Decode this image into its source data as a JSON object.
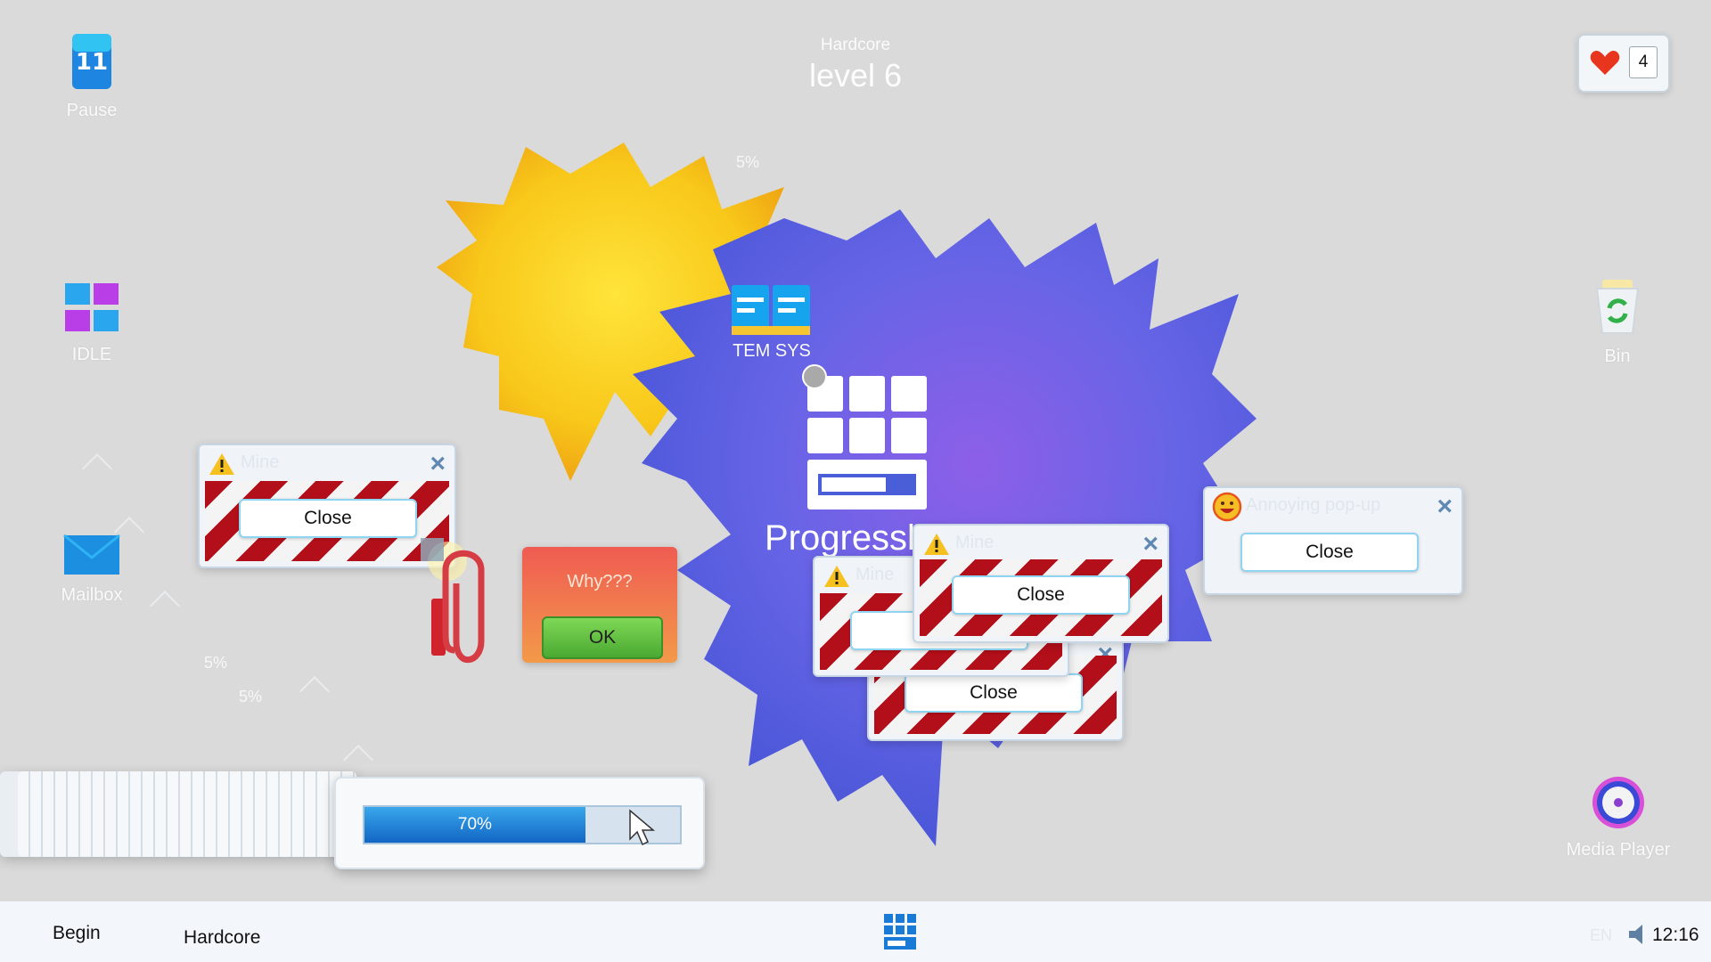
{
  "header": {
    "mode": "Hardcore",
    "level": "level 6"
  },
  "lives": {
    "count": "4"
  },
  "desktop_icons": {
    "pause": "Pause",
    "idle": "IDLE",
    "mailbox": "Mailbox",
    "tem_sys": "TEM SYS",
    "bin": "Bin",
    "media_player": "Media Player"
  },
  "floating_pct": [
    "5%",
    "5%",
    "5%"
  ],
  "center_title": "Progressbar 11",
  "popups": {
    "mine_left": {
      "title": "Mine",
      "close": "Close"
    },
    "annoying": {
      "title": "Annoying pop-up",
      "close": "Close"
    },
    "mine_center_front": {
      "title": "Mine",
      "close": "Close"
    },
    "mine_center_back": {
      "title": "Mine",
      "close": "Close"
    },
    "mine_center_bottom": {
      "close": "Close"
    },
    "why": {
      "title": "Why???",
      "ok": "OK"
    }
  },
  "progress": {
    "value": 0.7,
    "label": "70%"
  },
  "taskbar": {
    "begin": "Begin",
    "mode": "Hardcore",
    "lang": "EN",
    "clock": "12:16"
  },
  "colors": {
    "accent_blue": "#1a7bd6",
    "stripe_red": "#b30f1a",
    "ok_green": "#5bbf3c",
    "flower_yellow": "#f8c81a",
    "flower_purple": "#6a5fe3"
  }
}
